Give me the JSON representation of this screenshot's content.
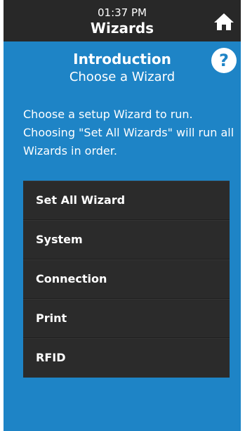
{
  "header": {
    "time": "01:37 PM",
    "title": "Wizards",
    "home_icon": "home-icon",
    "background": "#282828"
  },
  "main": {
    "heading": "Introduction",
    "subheading": "Choose a Wizard",
    "help_icon": "question-mark-icon",
    "help_label": "?",
    "description": "Choose a setup Wizard to run. Choosing \"Set All Wizards\" will run all Wizards in order.",
    "background": "#1e84c6"
  },
  "wizards": [
    {
      "label": "Set All Wizard"
    },
    {
      "label": "System"
    },
    {
      "label": "Connection"
    },
    {
      "label": "Print"
    },
    {
      "label": "RFID"
    }
  ]
}
